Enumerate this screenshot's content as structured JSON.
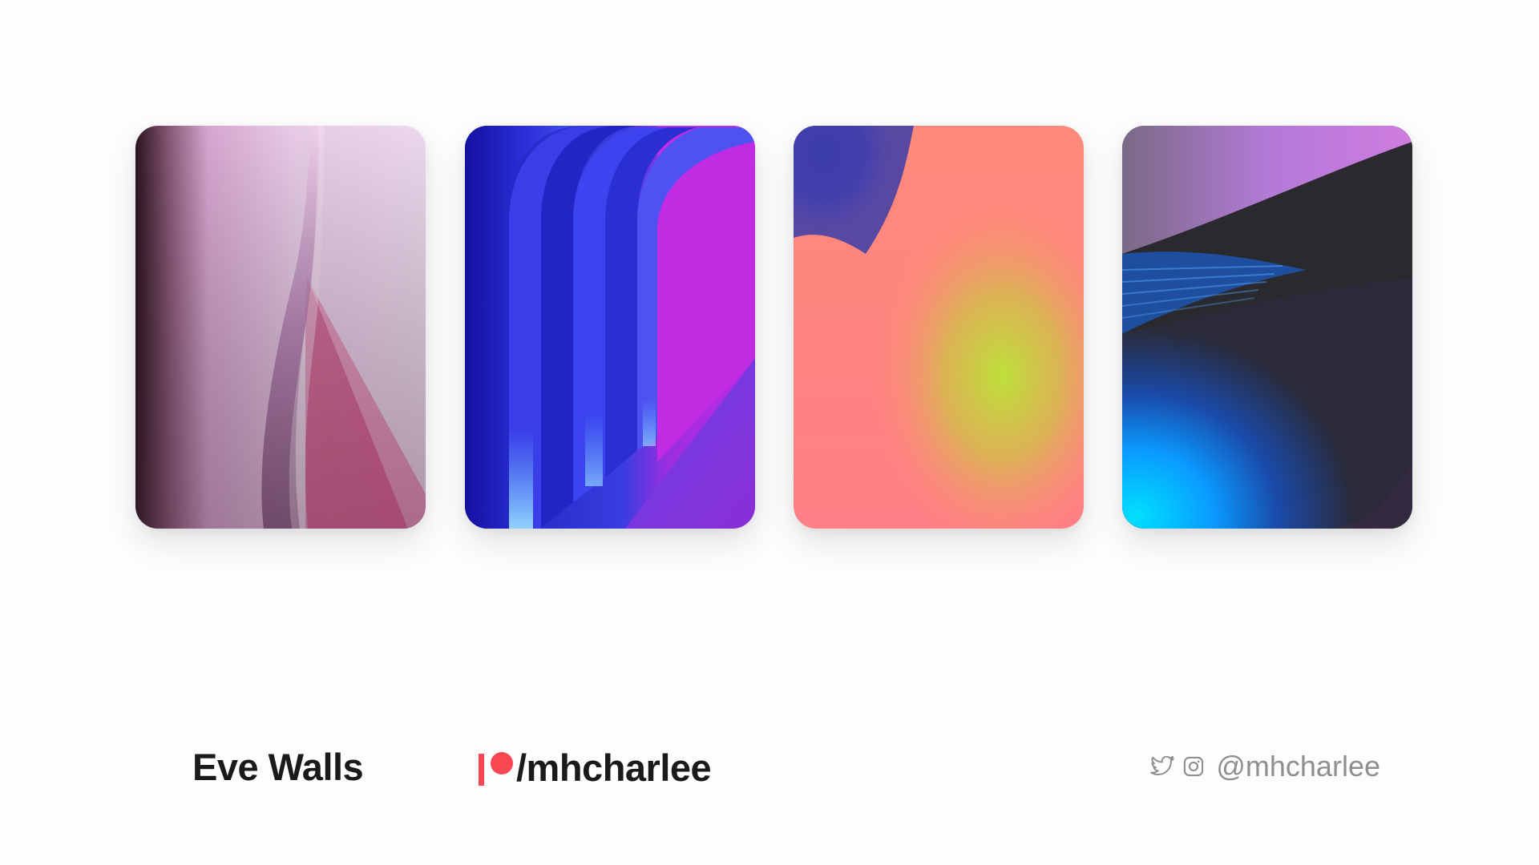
{
  "wallpapers": [
    {
      "name": "pink-abstract-wallpaper"
    },
    {
      "name": "blue-purple-arches-wallpaper"
    },
    {
      "name": "gradient-mesh-wallpaper"
    },
    {
      "name": "dark-blue-wave-wallpaper"
    }
  ],
  "footer": {
    "title": "Eve Walls",
    "patreon_handle": "/mhcharlee",
    "social_handle": "@mhcharlee",
    "icons": [
      "patreon-icon",
      "twitter-icon",
      "instagram-icon"
    ]
  },
  "colors": {
    "background": "#fdfdfd",
    "text": "#1a1a1a",
    "muted": "#8f8f8f",
    "patreon_accent": "#f94653"
  }
}
